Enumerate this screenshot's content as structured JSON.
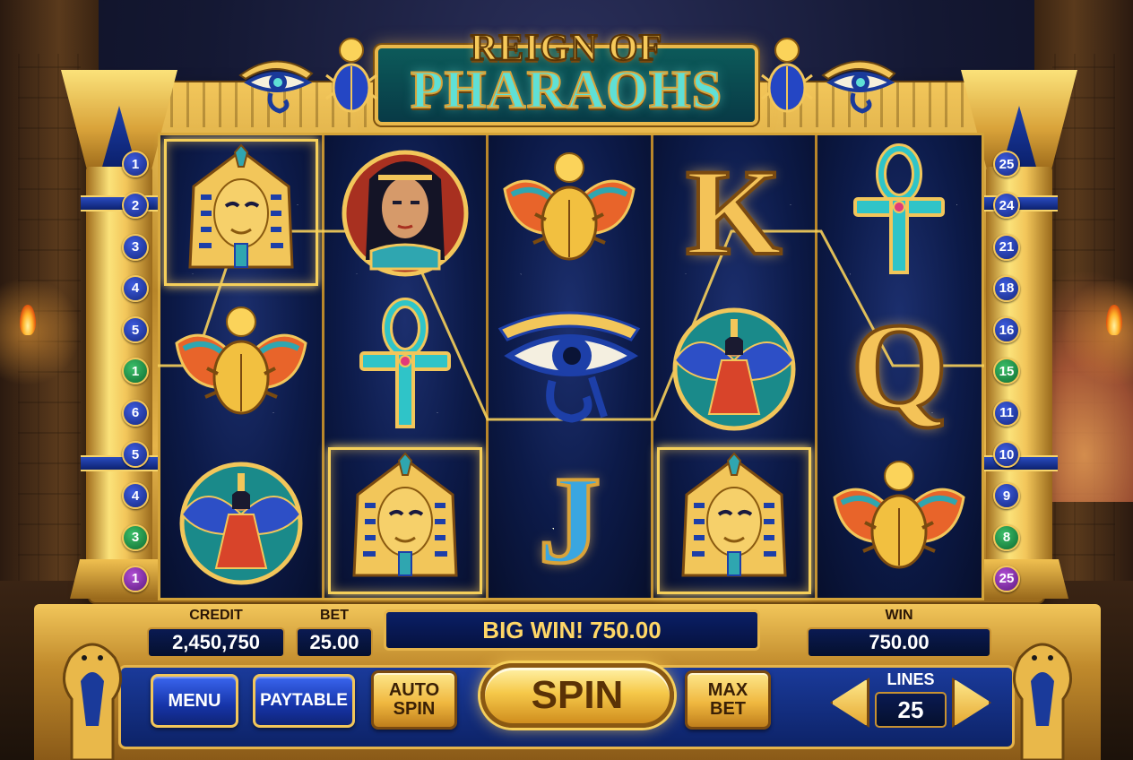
{
  "game": {
    "title_line1": "REIGN OF",
    "title_line2": "PHARAOHS"
  },
  "reels": [
    [
      {
        "symbol": "pharaoh",
        "icon": "pharaoh-mask-icon",
        "win": true
      },
      {
        "symbol": "scarab",
        "icon": "scarab-icon",
        "win": false
      },
      {
        "symbol": "isis",
        "icon": "winged-goddess-icon",
        "win": false
      }
    ],
    [
      {
        "symbol": "cleopatra",
        "icon": "cleopatra-portrait-icon",
        "win": false
      },
      {
        "symbol": "ankh",
        "icon": "ankh-icon",
        "win": false
      },
      {
        "symbol": "pharaoh",
        "icon": "pharaoh-mask-icon",
        "win": true
      }
    ],
    [
      {
        "symbol": "scarab",
        "icon": "scarab-icon",
        "win": false
      },
      {
        "symbol": "eye",
        "icon": "eye-of-horus-icon",
        "win": false
      },
      {
        "symbol": "J",
        "icon": "letter-j-icon",
        "win": false
      }
    ],
    [
      {
        "symbol": "K",
        "icon": "letter-k-icon",
        "win": false
      },
      {
        "symbol": "isis",
        "icon": "winged-goddess-icon",
        "win": false
      },
      {
        "symbol": "pharaoh",
        "icon": "pharaoh-mask-icon",
        "win": true
      }
    ],
    [
      {
        "symbol": "ankh",
        "icon": "ankh-icon",
        "win": false
      },
      {
        "symbol": "Q",
        "icon": "letter-q-icon",
        "win": false
      },
      {
        "symbol": "scarab",
        "icon": "scarab-icon",
        "win": false
      }
    ]
  ],
  "lines_left": [
    {
      "n": "1",
      "color": "blue"
    },
    {
      "n": "2",
      "color": "blue"
    },
    {
      "n": "3",
      "color": "blue"
    },
    {
      "n": "4",
      "color": "blue"
    },
    {
      "n": "5",
      "color": "blue"
    },
    {
      "n": "1",
      "color": "green"
    },
    {
      "n": "6",
      "color": "blue"
    },
    {
      "n": "5",
      "color": "blue"
    },
    {
      "n": "4",
      "color": "blue"
    },
    {
      "n": "3",
      "color": "green"
    },
    {
      "n": "1",
      "color": "purple"
    }
  ],
  "lines_right": [
    {
      "n": "25",
      "color": "blue"
    },
    {
      "n": "24",
      "color": "blue"
    },
    {
      "n": "21",
      "color": "blue"
    },
    {
      "n": "18",
      "color": "blue"
    },
    {
      "n": "16",
      "color": "blue"
    },
    {
      "n": "15",
      "color": "green"
    },
    {
      "n": "11",
      "color": "blue"
    },
    {
      "n": "10",
      "color": "blue"
    },
    {
      "n": "9",
      "color": "blue"
    },
    {
      "n": "8",
      "color": "green"
    },
    {
      "n": "25",
      "color": "purple"
    }
  ],
  "panel": {
    "credit_label": "CREDIT",
    "credit_value": "2,450,750",
    "bet_label": "BET",
    "bet_value": "25.00",
    "message": "BIG WIN! 750.00",
    "win_label": "WIN",
    "win_value": "750.00",
    "lines_label": "LINES",
    "lines_value": "25"
  },
  "buttons": {
    "menu": "MENU",
    "paytable": "PAYTABLE",
    "auto_spin_1": "AUTO",
    "auto_spin_2": "SPIN",
    "spin": "SPIN",
    "max_bet_1": "MAX",
    "max_bet_2": "BET"
  },
  "colors": {
    "gold": "#f2c65a",
    "reel_bg": "#0c1a48",
    "teal": "#5fe0d6",
    "panel_blue": "#1634a8"
  }
}
